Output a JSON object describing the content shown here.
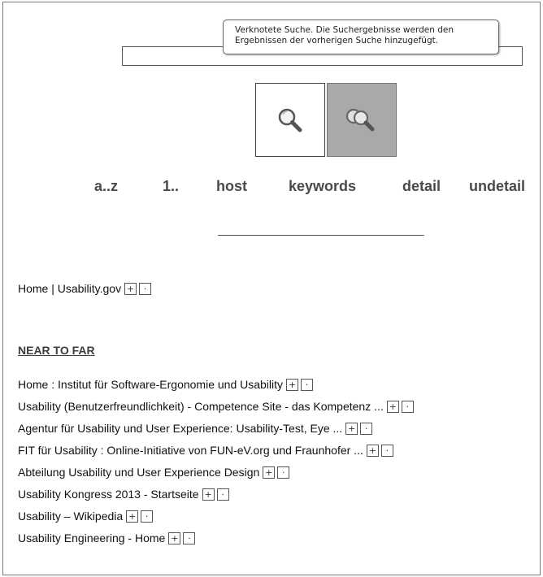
{
  "tooltip": {
    "line1": "Verknotete Suche. Die Suchergebnisse werden den",
    "line2": "Ergebnissen der vorherigen Suche hinzugefügt."
  },
  "search": {
    "value": ""
  },
  "buttons": {
    "single_icon": "magnifier-icon",
    "chained_icon": "double-magnifier-icon"
  },
  "sort_links": [
    "a..z",
    "1..",
    "host",
    "keywords",
    "detail",
    "undetail"
  ],
  "breadcrumb": {
    "label": "Home | Usability.gov",
    "add": "+",
    "remove": "·"
  },
  "section": {
    "heading": "NEAR TO FAR"
  },
  "results": [
    {
      "label": "Home : Institut für Software-Ergonomie und Usability",
      "add": "+",
      "remove": "·"
    },
    {
      "label": "Usability (Benutzerfreundlichkeit) - Competence Site - das Kompetenz ...",
      "add": "+",
      "remove": "·"
    },
    {
      "label": "Agentur für Usability und User Experience: Usability-Test, Eye ...",
      "add": "+",
      "remove": "·"
    },
    {
      "label": "FIT für Usability : Online-Initiative von FUN-eV.org und Fraunhofer ...",
      "add": "+",
      "remove": "·"
    },
    {
      "label": "Abteilung Usability und User Experience Design",
      "add": "+",
      "remove": "·"
    },
    {
      "label": "Usability Kongress 2013 - Startseite",
      "add": "+",
      "remove": "·"
    },
    {
      "label": "Usability – Wikipedia",
      "add": "+",
      "remove": "·"
    },
    {
      "label": "Usability Engineering - Home",
      "add": "+",
      "remove": "·"
    }
  ]
}
